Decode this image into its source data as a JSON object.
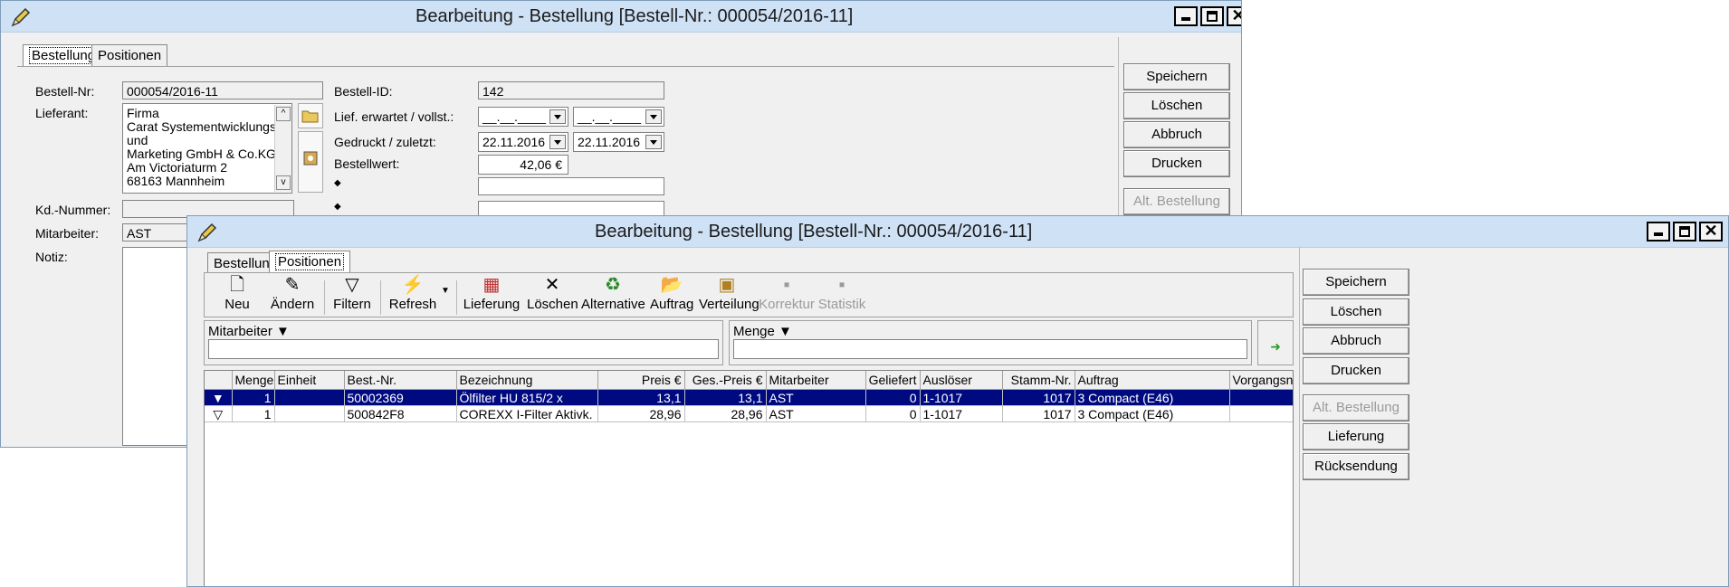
{
  "back_window": {
    "title": "Bearbeitung - Bestellung [Bestell-Nr.: 000054/2016-11]",
    "tabs": [
      "Bestellung",
      "Positionen"
    ],
    "form": {
      "bestell_nr_label": "Bestell-Nr:",
      "bestell_nr_value": "000054/2016-11",
      "lieferant_label": "Lieferant:",
      "lieferant_lines": [
        "Firma",
        "Carat Systementwicklungs-",
        "und",
        "Marketing GmbH & Co.KG",
        "Am Victoriaturm 2",
        "68163 Mannheim"
      ],
      "kd_nummer_label": "Kd.-Nummer:",
      "mitarbeiter_label": "Mitarbeiter:",
      "mitarbeiter_value": "AST",
      "notiz_label": "Notiz:",
      "bestell_id_label": "Bestell-ID:",
      "bestell_id_value": "142",
      "lief_label": "Lief. erwartet / vollst.:",
      "lief_date1": "__.__.____",
      "lief_date2": "__.__.____",
      "gedruckt_label": "Gedruckt / zuletzt:",
      "gedruckt_date1": "22.11.2016",
      "gedruckt_date2": "22.11.2016",
      "bestellwert_label": "Bestellwert:",
      "bestellwert_value": "42,06 €"
    },
    "side_buttons": [
      "Speichern",
      "Löschen",
      "Abbruch",
      "Drucken",
      "Alt. Bestellung"
    ]
  },
  "front_window": {
    "title": "Bearbeitung - Bestellung [Bestell-Nr.: 000054/2016-11]",
    "tabs": [
      "Bestellung",
      "Positionen"
    ],
    "toolbar": {
      "neu": "Neu",
      "aendern": "Ändern",
      "filtern": "Filtern",
      "refresh": "Refresh",
      "lieferung": "Lieferung",
      "loeschen": "Löschen",
      "alternative": "Alternative",
      "auftrag": "Auftrag",
      "verteilung": "Verteilung",
      "korrektur": "Korrektur",
      "statistik": "Statistik"
    },
    "filters": {
      "mitarbeiter": "Mitarbeiter ▼",
      "menge": "Menge ▼"
    },
    "columns": [
      "Menge",
      "Einheit",
      "Best.-Nr.",
      "Bezeichnung",
      "Preis €",
      "Ges.-Preis €",
      "Mitarbeiter",
      "Geliefert",
      "Auslöser",
      "Stamm-Nr.",
      "Auftrag",
      "Vorgangsnr"
    ],
    "rows": [
      {
        "menge": "1",
        "einheit": "",
        "best_nr": "50002369",
        "bezeichnung": "Ölfilter HU 815/2 x",
        "preis": "13,1",
        "ges_preis": "13,1",
        "mitarbeiter": "AST",
        "geliefert": "0",
        "ausloeser": "1-1017",
        "stamm_nr": "1017",
        "auftrag": "3 Compact (E46)",
        "vorgangsnr": ""
      },
      {
        "menge": "1",
        "einheit": "",
        "best_nr": "500842F8",
        "bezeichnung": "COREXX I-Filter Aktivk.",
        "preis": "28,96",
        "ges_preis": "28,96",
        "mitarbeiter": "AST",
        "geliefert": "0",
        "ausloeser": "1-1017",
        "stamm_nr": "1017",
        "auftrag": "3 Compact (E46)",
        "vorgangsnr": ""
      }
    ],
    "side_buttons": [
      "Speichern",
      "Löschen",
      "Abbruch",
      "Drucken",
      "Alt. Bestellung",
      "Lieferung",
      "Rücksendung"
    ]
  },
  "colors": {
    "titlebar": "#cfe1f5",
    "selection": "#000a80",
    "window_bg": "#f0f0f0"
  }
}
